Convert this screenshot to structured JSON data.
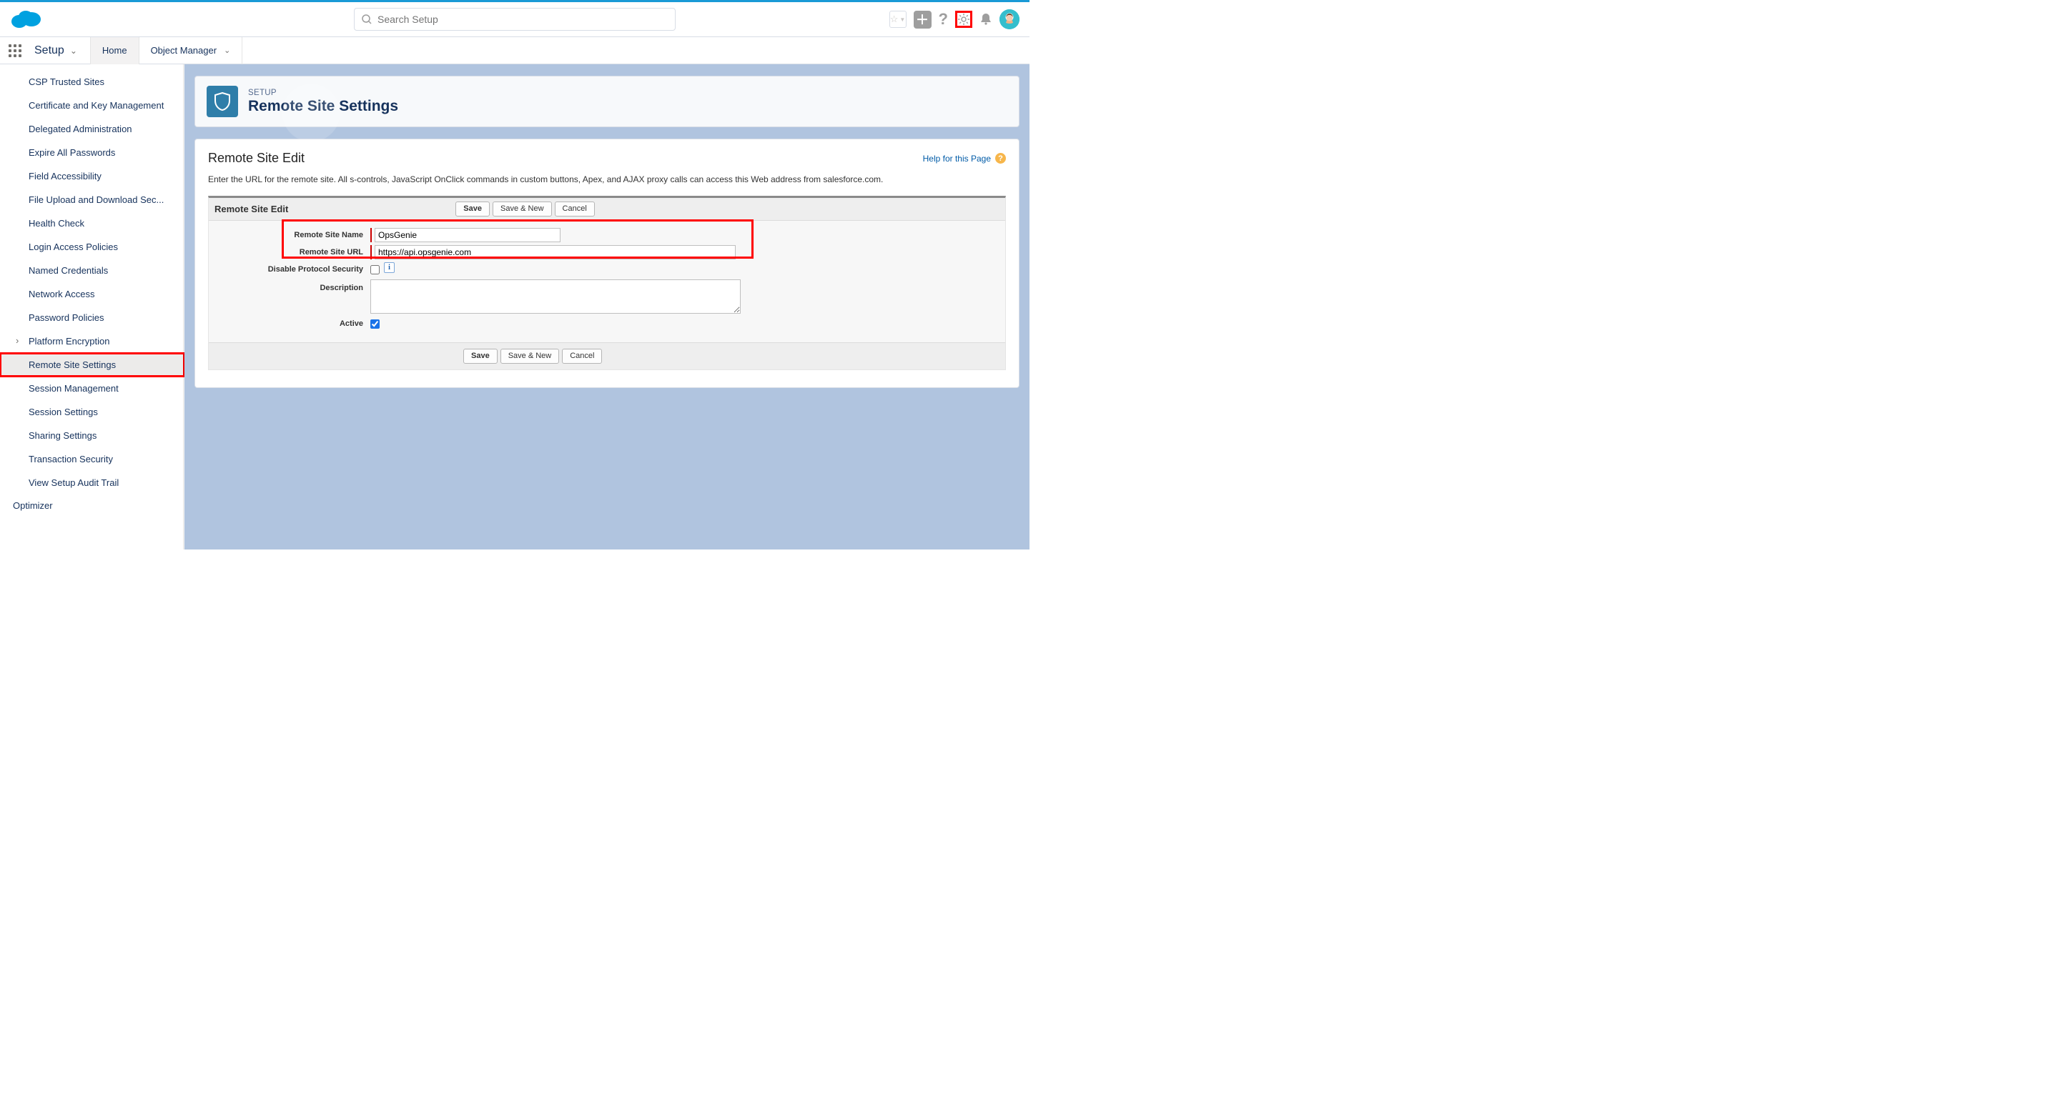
{
  "header": {
    "search_placeholder": "Search Setup"
  },
  "context": {
    "app_label": "Setup",
    "tabs": [
      {
        "label": "Home"
      },
      {
        "label": "Object Manager"
      }
    ]
  },
  "sidebar": {
    "items": [
      {
        "label": "CSP Trusted Sites"
      },
      {
        "label": "Certificate and Key Management"
      },
      {
        "label": "Delegated Administration"
      },
      {
        "label": "Expire All Passwords"
      },
      {
        "label": "Field Accessibility"
      },
      {
        "label": "File Upload and Download Sec..."
      },
      {
        "label": "Health Check"
      },
      {
        "label": "Login Access Policies"
      },
      {
        "label": "Named Credentials"
      },
      {
        "label": "Network Access"
      },
      {
        "label": "Password Policies"
      },
      {
        "label": "Platform Encryption",
        "expandable": true
      },
      {
        "label": "Remote Site Settings",
        "selected": true,
        "highlighted": true
      },
      {
        "label": "Session Management"
      },
      {
        "label": "Session Settings"
      },
      {
        "label": "Sharing Settings"
      },
      {
        "label": "Transaction Security"
      },
      {
        "label": "View Setup Audit Trail"
      }
    ],
    "group_label": "Optimizer"
  },
  "page": {
    "eyebrow": "SETUP",
    "title": "Remote Site Settings",
    "classic_title": "Remote Site Edit",
    "help_text": "Help for this Page",
    "description": "Enter the URL for the remote site. All s-controls, JavaScript OnClick commands in custom buttons, Apex, and AJAX proxy calls can access this Web address from salesforce.com.",
    "section_title": "Remote Site Edit",
    "buttons": {
      "save": "Save",
      "save_new": "Save & New",
      "cancel": "Cancel"
    },
    "form": {
      "labels": {
        "name": "Remote Site Name",
        "url": "Remote Site URL",
        "disable_protocol": "Disable Protocol Security",
        "description": "Description",
        "active": "Active"
      },
      "values": {
        "name": "OpsGenie",
        "url": "https://api.opsgenie.com",
        "disable_protocol": false,
        "description": "",
        "active": true
      }
    }
  }
}
